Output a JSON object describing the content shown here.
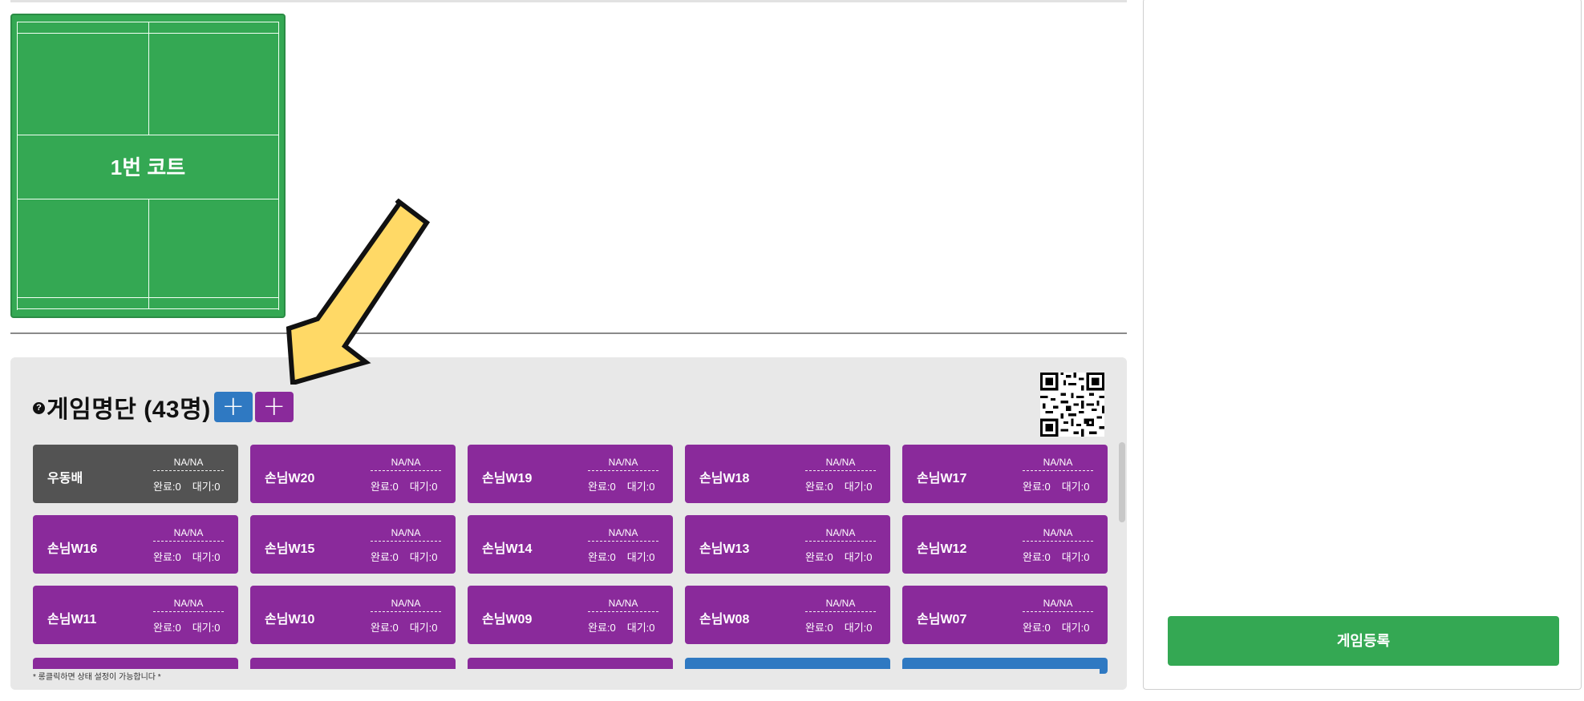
{
  "court": {
    "label": "1번 코트"
  },
  "game_list": {
    "title": "게임명단 (43명)",
    "help_icon": "question-circle-icon",
    "add_blue_label": "+",
    "add_purple_label": "+",
    "note": "* 롱클릭하면 상태 설정이 가능합니다 *",
    "players": [
      {
        "name": "우동배",
        "score": "NA/NA",
        "done": "완료:0",
        "wait": "대기:0",
        "color": "gray"
      },
      {
        "name": "손님W20",
        "score": "NA/NA",
        "done": "완료:0",
        "wait": "대기:0",
        "color": "purple"
      },
      {
        "name": "손님W19",
        "score": "NA/NA",
        "done": "완료:0",
        "wait": "대기:0",
        "color": "purple"
      },
      {
        "name": "손님W18",
        "score": "NA/NA",
        "done": "완료:0",
        "wait": "대기:0",
        "color": "purple"
      },
      {
        "name": "손님W17",
        "score": "NA/NA",
        "done": "완료:0",
        "wait": "대기:0",
        "color": "purple"
      },
      {
        "name": "손님W16",
        "score": "NA/NA",
        "done": "완료:0",
        "wait": "대기:0",
        "color": "purple"
      },
      {
        "name": "손님W15",
        "score": "NA/NA",
        "done": "완료:0",
        "wait": "대기:0",
        "color": "purple"
      },
      {
        "name": "손님W14",
        "score": "NA/NA",
        "done": "완료:0",
        "wait": "대기:0",
        "color": "purple"
      },
      {
        "name": "손님W13",
        "score": "NA/NA",
        "done": "완료:0",
        "wait": "대기:0",
        "color": "purple"
      },
      {
        "name": "손님W12",
        "score": "NA/NA",
        "done": "완료:0",
        "wait": "대기:0",
        "color": "purple"
      },
      {
        "name": "손님W11",
        "score": "NA/NA",
        "done": "완료:0",
        "wait": "대기:0",
        "color": "purple"
      },
      {
        "name": "손님W10",
        "score": "NA/NA",
        "done": "완료:0",
        "wait": "대기:0",
        "color": "purple"
      },
      {
        "name": "손님W09",
        "score": "NA/NA",
        "done": "완료:0",
        "wait": "대기:0",
        "color": "purple"
      },
      {
        "name": "손님W08",
        "score": "NA/NA",
        "done": "완료:0",
        "wait": "대기:0",
        "color": "purple"
      },
      {
        "name": "손님W07",
        "score": "NA/NA",
        "done": "완료:0",
        "wait": "대기:0",
        "color": "purple"
      }
    ],
    "partial_row_colors": [
      "purple",
      "purple",
      "purple",
      "blue",
      "blue"
    ]
  },
  "right_panel": {
    "register_label": "게임등록"
  },
  "colors": {
    "court_green": "#34a853",
    "purple": "#8a2a9b",
    "blue": "#2f79c2",
    "gray": "#535353",
    "arrow_yellow": "#ffd966"
  }
}
